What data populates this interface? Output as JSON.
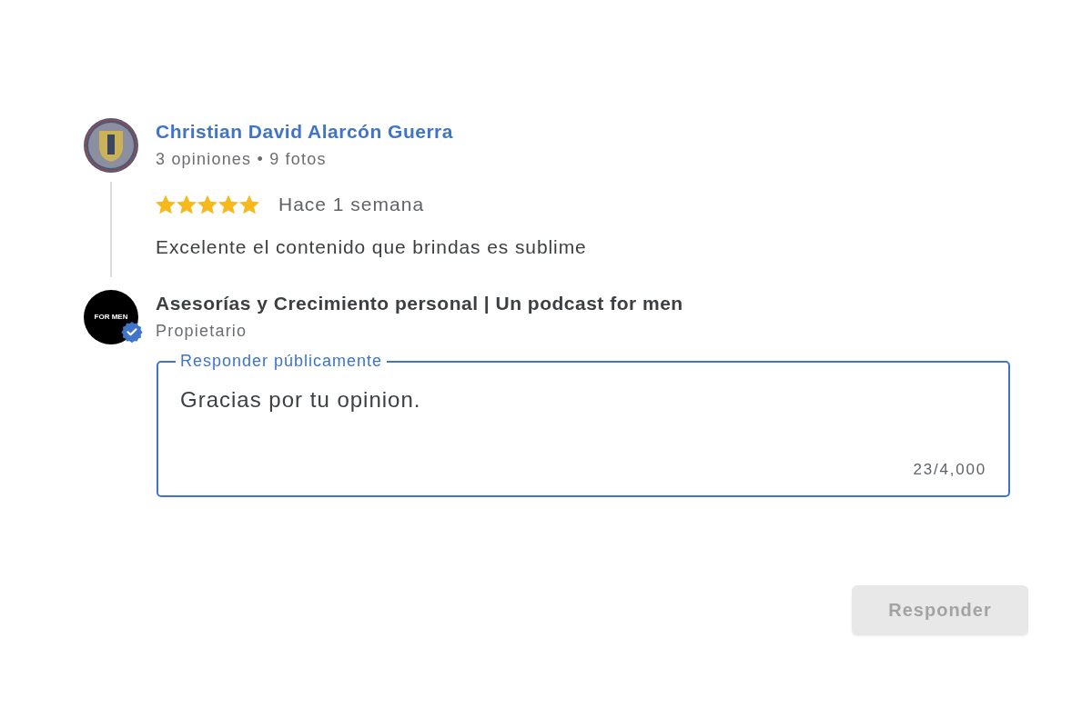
{
  "review": {
    "reviewer": {
      "name": "Christian David Alarcón Guerra",
      "stats": "3 opiniones • 9 fotos"
    },
    "stars": 5,
    "time": "Hace 1 semana",
    "text": "Excelente el contenido que brindas es sublime"
  },
  "owner_reply": {
    "avatar_text": "FOR MEN",
    "verified": true,
    "name": "Asesorías y Crecimiento personal | Un podcast for men",
    "role": "Propietario",
    "field": {
      "label": "Responder públicamente",
      "value": "Gracias por tu opinion.",
      "focused": true,
      "counter": "23/4,000"
    }
  },
  "submit_button": {
    "label": "Responder",
    "disabled": true
  }
}
